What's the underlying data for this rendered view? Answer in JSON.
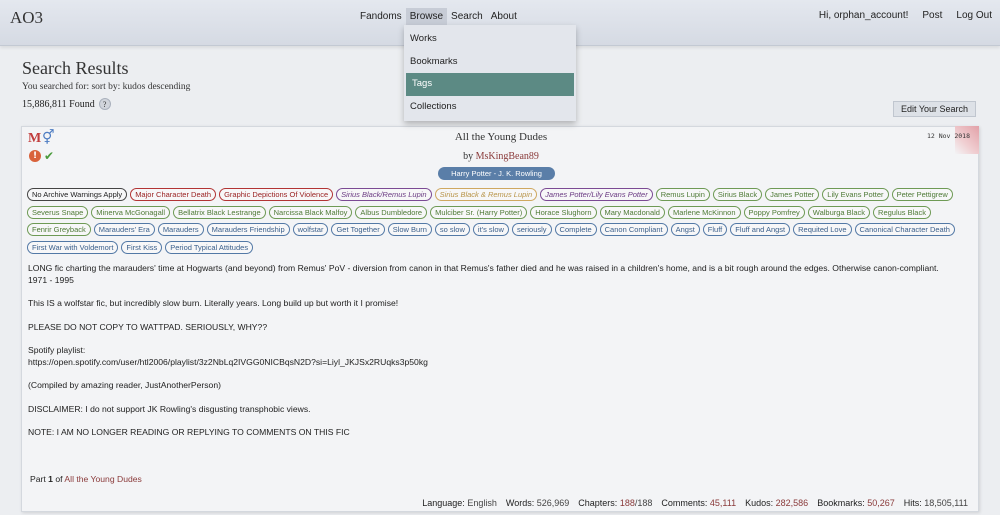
{
  "header": {
    "logo": "AO3",
    "nav": [
      "Fandoms",
      "Browse",
      "Search",
      "About"
    ],
    "user": [
      "Hi, orphan_account!",
      "Post",
      "Log Out"
    ]
  },
  "dropdown": {
    "items": [
      "Works",
      "Bookmarks",
      "Tags",
      "Collections"
    ],
    "selected": "Tags"
  },
  "page": {
    "title": "Search Results",
    "searched_for": "You searched for: sort by: kudos descending",
    "found": "15,886,811 Found",
    "help_icon": "?",
    "edit_button": "Edit Your Search"
  },
  "work": {
    "title": "All the Young Dudes",
    "by_label": "by",
    "author": "MsKingBean89",
    "date": "12 Nov 2018",
    "fandom": "Harry Potter - J. K. Rowling",
    "symbols": {
      "rating": "M",
      "category": "⚥",
      "warning": "!",
      "complete": "✔"
    },
    "tags": [
      {
        "text": "No Archive Warnings Apply",
        "kind": "w"
      },
      {
        "text": "Major Character Death",
        "kind": "wr"
      },
      {
        "text": "Graphic Depictions Of Violence",
        "kind": "wr"
      },
      {
        "text": "Sirius Black/Remus Lupin",
        "kind": "rel"
      },
      {
        "text": "Sirius Black & Remus Lupin",
        "kind": "rel2"
      },
      {
        "text": "James Potter/Lily Evans Potter",
        "kind": "rel"
      },
      {
        "text": "Remus Lupin",
        "kind": "ch"
      },
      {
        "text": "Sirius Black",
        "kind": "ch"
      },
      {
        "text": "James Potter",
        "kind": "ch"
      },
      {
        "text": "Lily Evans Potter",
        "kind": "ch"
      },
      {
        "text": "Peter Pettigrew",
        "kind": "ch"
      },
      {
        "text": "Severus Snape",
        "kind": "ch"
      },
      {
        "text": "Minerva McGonagall",
        "kind": "ch"
      },
      {
        "text": "Bellatrix Black Lestrange",
        "kind": "ch"
      },
      {
        "text": "Narcissa Black Malfoy",
        "kind": "ch"
      },
      {
        "text": "Albus Dumbledore",
        "kind": "ch"
      },
      {
        "text": "Mulciber Sr. (Harry Potter)",
        "kind": "ch"
      },
      {
        "text": "Horace Slughorn",
        "kind": "ch"
      },
      {
        "text": "Mary Macdonald",
        "kind": "ch"
      },
      {
        "text": "Marlene McKinnon",
        "kind": "ch"
      },
      {
        "text": "Poppy Pomfrey",
        "kind": "ch"
      },
      {
        "text": "Walburga Black",
        "kind": "ch"
      },
      {
        "text": "Regulus Black",
        "kind": "ch"
      },
      {
        "text": "Fenrir Greyback",
        "kind": "ch"
      },
      {
        "text": "Marauders' Era",
        "kind": "fr"
      },
      {
        "text": "Marauders",
        "kind": "fr"
      },
      {
        "text": "Marauders Friendship",
        "kind": "fr"
      },
      {
        "text": "wolfstar",
        "kind": "fr"
      },
      {
        "text": "Get Together",
        "kind": "fr"
      },
      {
        "text": "Slow Burn",
        "kind": "fr"
      },
      {
        "text": "so slow",
        "kind": "fr"
      },
      {
        "text": "it's slow",
        "kind": "fr"
      },
      {
        "text": "seriously",
        "kind": "fr"
      },
      {
        "text": "Complete",
        "kind": "fr"
      },
      {
        "text": "Canon Compliant",
        "kind": "fr"
      },
      {
        "text": "Angst",
        "kind": "fr"
      },
      {
        "text": "Fluff",
        "kind": "fr"
      },
      {
        "text": "Fluff and Angst",
        "kind": "fr"
      },
      {
        "text": "Requited Love",
        "kind": "fr"
      },
      {
        "text": "Canonical Character Death",
        "kind": "fr"
      },
      {
        "text": "First War with Voldemort",
        "kind": "fr"
      },
      {
        "text": "First Kiss",
        "kind": "fr"
      },
      {
        "text": "Period Typical Attitudes",
        "kind": "fr"
      }
    ],
    "summary": [
      "LONG fic charting the marauders' time at Hogwarts (and beyond) from Remus' PoV - diversion from canon in that Remus's father died and he was raised in a children's home, and is a bit rough around the edges. Otherwise canon-compliant.\n1971 - 1995",
      "This IS a wolfstar fic, but incredibly slow burn. Literally years. Long build up but worth it I promise!",
      "PLEASE DO NOT COPY TO WATTPAD. SERIOUSLY, WHY??",
      "Spotify playlist:\nhttps://open.spotify.com/user/htl2006/playlist/3z2NbLq2IVGG0NICBqsN2D?si=Liyl_JKJSx2RUqks3p50kg",
      "(Compiled by amazing reader, JustAnotherPerson)",
      " DISCLAIMER: I do not support JK Rowling's disgusting transphobic views.",
      "NOTE: I AM NO LONGER READING OR REPLYING TO COMMENTS ON THIS FIC"
    ],
    "series": {
      "prefix": "Part",
      "part": "1",
      "of": "of",
      "name": "All the Young Dudes"
    },
    "stats": {
      "language_label": "Language:",
      "language": "English",
      "words_label": "Words:",
      "words": "526,969",
      "chapters_label": "Chapters:",
      "chapters_done": "188",
      "chapters_total": "/188",
      "comments_label": "Comments:",
      "comments": "45,111",
      "kudos_label": "Kudos:",
      "kudos": "282,586",
      "bookmarks_label": "Bookmarks:",
      "bookmarks": "50,267",
      "hits_label": "Hits:",
      "hits": "18,505,111"
    }
  }
}
